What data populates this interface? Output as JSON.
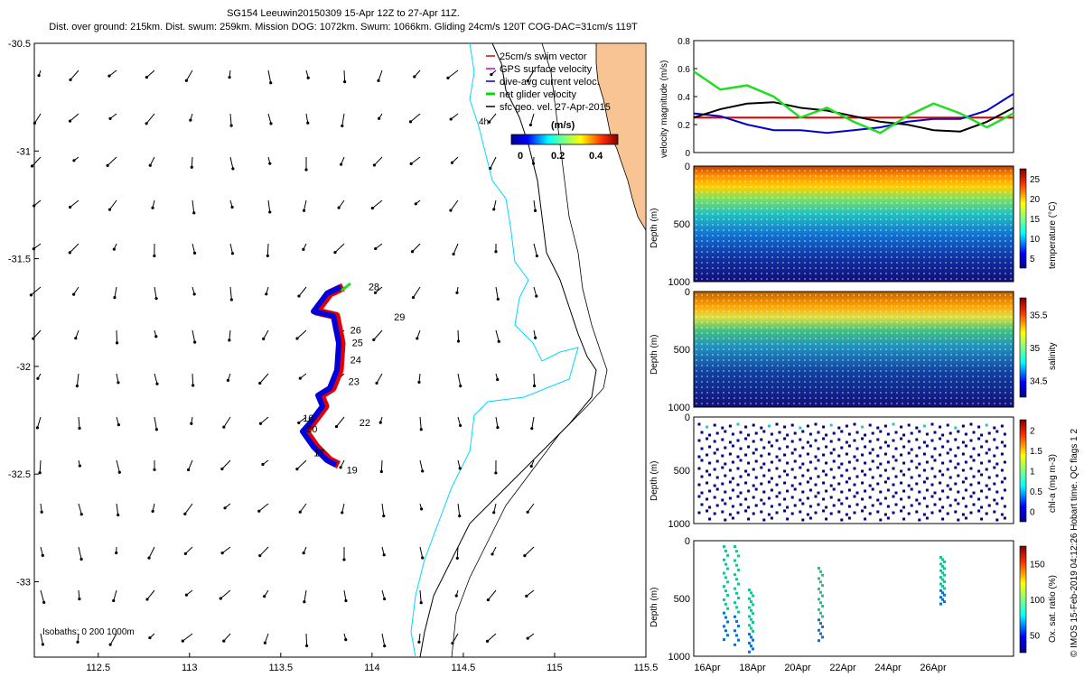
{
  "header": {
    "line1": "SG154 Leeuwin20150309 15-Apr 12Z to 27-Apr 11Z.",
    "line2": "Dist. over ground: 215km. Dist. swum: 259km. Mission DOG: 1072km. Swum: 1066km. Gliding 24cm/s 120T COG-DAC=31cm/s 119T"
  },
  "legend": {
    "items": [
      {
        "label": "25cm/s swim vector",
        "color": "#e00000"
      },
      {
        "label": "GPS surface velocity",
        "color": "#cc00cc"
      },
      {
        "label": "dive-avg current veloc.",
        "color": "#0000cc"
      },
      {
        "label": "net glider velocity",
        "color": "#00dd00"
      },
      {
        "label": "sfc geo. vel. 27-Apr-2015",
        "color": "#000000"
      }
    ],
    "colorbar_title": "(m/s)",
    "colorbar_ticks": [
      "0",
      "0.2",
      "0.4"
    ],
    "scale_arrow_label": "4h"
  },
  "isobaths_label": "Isobaths: 0   200  1000m",
  "copyright": "© IMOS 15-Feb-2019 04:12:26 Hobart time. QC flags 1  2",
  "chart_data": [
    {
      "type": "scatter",
      "name": "map",
      "xlabel": "",
      "ylabel": "",
      "xlim": [
        112.15,
        115.5
      ],
      "ylim": [
        -33.35,
        -30.5
      ],
      "x_ticks": [
        "112.5",
        "113",
        "113.5",
        "114",
        "114.5",
        "115",
        "115.5"
      ],
      "y_ticks": [
        "-30.5",
        "-31",
        "-31.5",
        "-32",
        "-32.5",
        "-33"
      ],
      "track_labels": [
        {
          "text": "28",
          "x": 113.98,
          "y": -31.63
        },
        {
          "text": "29",
          "x": 114.12,
          "y": -31.77
        },
        {
          "text": "26",
          "x": 113.88,
          "y": -31.83
        },
        {
          "text": "25",
          "x": 113.89,
          "y": -31.89
        },
        {
          "text": "24",
          "x": 113.88,
          "y": -31.97
        },
        {
          "text": "23",
          "x": 113.87,
          "y": -32.07
        },
        {
          "text": "22",
          "x": 113.93,
          "y": -32.26
        },
        {
          "text": "16",
          "x": 113.62,
          "y": -32.24
        },
        {
          "text": "20",
          "x": 113.64,
          "y": -32.29
        },
        {
          "text": "17",
          "x": 113.68,
          "y": -32.4
        },
        {
          "text": "19",
          "x": 113.86,
          "y": -32.48
        }
      ]
    },
    {
      "type": "line",
      "name": "velocity",
      "ylabel": "velocity magnitude (m/s)",
      "ylim": [
        0,
        0.8
      ],
      "y_ticks": [
        "0",
        "0.2",
        "0.4",
        "0.6",
        "0.8"
      ],
      "series": [
        {
          "color": "#e00000",
          "values": [
            0.25,
            0.25,
            0.25,
            0.25,
            0.25,
            0.25,
            0.25,
            0.25,
            0.25,
            0.25,
            0.25,
            0.25,
            0.25
          ]
        },
        {
          "color": "#0000cc",
          "values": [
            0.28,
            0.26,
            0.2,
            0.16,
            0.16,
            0.14,
            0.16,
            0.18,
            0.22,
            0.24,
            0.24,
            0.3,
            0.42
          ]
        },
        {
          "color": "#000000",
          "values": [
            0.25,
            0.31,
            0.35,
            0.36,
            0.32,
            0.3,
            0.26,
            0.22,
            0.2,
            0.16,
            0.15,
            0.22,
            0.32
          ]
        },
        {
          "color": "#22dd22",
          "values": [
            0.58,
            0.45,
            0.48,
            0.4,
            0.25,
            0.32,
            0.22,
            0.14,
            0.26,
            0.35,
            0.28,
            0.18,
            0.28
          ]
        }
      ]
    },
    {
      "type": "heatmap",
      "name": "temperature",
      "ylabel": "Depth (m)",
      "cbar_label": "temperature (°C)",
      "y_ticks": [
        "0",
        "500",
        "1000"
      ],
      "cbar_ticks": [
        "5",
        "10",
        "15",
        "20",
        "25"
      ]
    },
    {
      "type": "heatmap",
      "name": "salinity",
      "ylabel": "Depth (m)",
      "cbar_label": "salinity",
      "y_ticks": [
        "0",
        "500",
        "1000"
      ],
      "cbar_ticks": [
        "34.5",
        "35",
        "35.5"
      ]
    },
    {
      "type": "scatter",
      "name": "chla",
      "ylabel": "Depth (m)",
      "cbar_label": "chl-a (mg m-3)",
      "y_ticks": [
        "0",
        "500",
        "1000"
      ],
      "cbar_ticks": [
        "0",
        "0.5",
        "1",
        "1.5",
        "2"
      ]
    },
    {
      "type": "scatter",
      "name": "oxygen",
      "ylabel": "Depth (m)",
      "cbar_label": "Ox. sat. ratio (%)",
      "y_ticks": [
        "0",
        "500",
        "1000"
      ],
      "cbar_ticks": [
        "50",
        "100",
        "150"
      ],
      "x_ticks": [
        "16Apr",
        "18Apr",
        "20Apr",
        "22Apr",
        "24Apr",
        "26Apr"
      ]
    }
  ]
}
